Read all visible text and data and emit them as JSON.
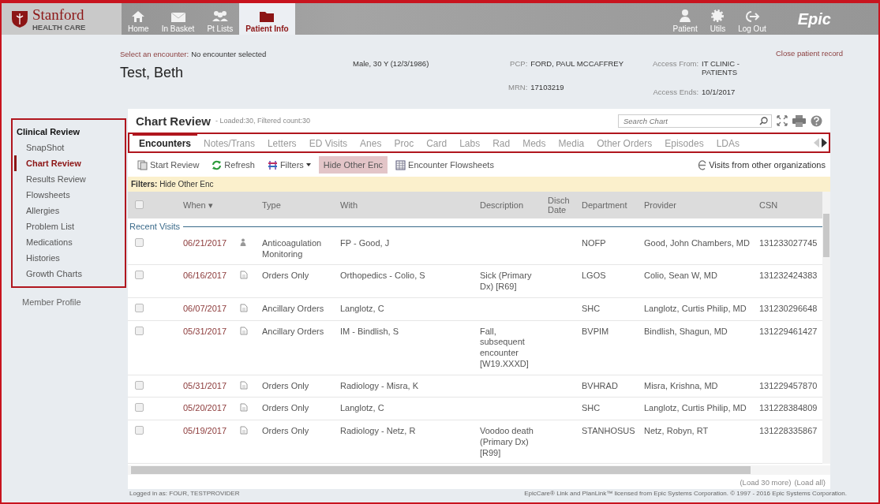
{
  "topbar": {
    "logo": {
      "name": "Stanford",
      "sub": "HEALTH CARE"
    },
    "nav_left": [
      {
        "label": "Home",
        "kind": "home",
        "selected": false
      },
      {
        "label": "In Basket",
        "kind": "mail",
        "selected": false
      },
      {
        "label": "Pt Lists",
        "kind": "people",
        "selected": false
      },
      {
        "label": "Patient Info",
        "kind": "folder",
        "selected": true
      }
    ],
    "nav_right": [
      {
        "label": "Patient",
        "kind": "person"
      },
      {
        "label": "Utils",
        "kind": "gear"
      },
      {
        "label": "Log Out",
        "kind": "logout"
      }
    ],
    "brand": "Epic"
  },
  "patient": {
    "encounter_label": "Select an encounter:",
    "encounter_value": "No encounter selected",
    "name": "Test, Beth",
    "demographics": "Male, 30 Y (12/3/1986)",
    "pcp_label": "PCP:",
    "pcp": "FORD, PAUL MCCAFFREY",
    "mrn_label": "MRN:",
    "mrn": "17103219",
    "access_from_label": "Access From:",
    "access_from": "IT CLINIC - PATIENTS",
    "access_ends_label": "Access Ends:",
    "access_ends": "10/1/2017",
    "close_link": "Close patient record"
  },
  "sidebar": {
    "heading": "Clinical Review",
    "items": [
      {
        "label": "SnapShot",
        "selected": false
      },
      {
        "label": "Chart Review",
        "selected": true
      },
      {
        "label": "Results Review",
        "selected": false
      },
      {
        "label": "Flowsheets",
        "selected": false
      },
      {
        "label": "Allergies",
        "selected": false
      },
      {
        "label": "Problem List",
        "selected": false
      },
      {
        "label": "Medications",
        "selected": false
      },
      {
        "label": "Histories",
        "selected": false
      },
      {
        "label": "Growth Charts",
        "selected": false
      }
    ],
    "other_items": [
      "Member Profile"
    ]
  },
  "chart_review": {
    "title": "Chart Review",
    "subtitle": "- Loaded:30, Filtered count:30",
    "search": {
      "placeholder": "Search Chart"
    },
    "tabs": [
      {
        "label": "Encounters",
        "selected": true
      },
      {
        "label": "Notes/Trans",
        "selected": false
      },
      {
        "label": "Letters",
        "selected": false
      },
      {
        "label": "ED Visits",
        "selected": false
      },
      {
        "label": "Anes",
        "selected": false
      },
      {
        "label": "Proc",
        "selected": false
      },
      {
        "label": "Card",
        "selected": false
      },
      {
        "label": "Labs",
        "selected": false
      },
      {
        "label": "Rad",
        "selected": false
      },
      {
        "label": "Meds",
        "selected": false
      },
      {
        "label": "Media",
        "selected": false
      },
      {
        "label": "Other Orders",
        "selected": false
      },
      {
        "label": "Episodes",
        "selected": false
      },
      {
        "label": "LDAs",
        "selected": false
      }
    ],
    "toolbar": [
      {
        "label": "Start Review",
        "kind": "review",
        "selected": false
      },
      {
        "label": "Refresh",
        "kind": "refresh",
        "selected": false
      },
      {
        "label": "Filters",
        "kind": "filters",
        "selected": false
      },
      {
        "label": "Hide Other Enc",
        "kind": "plain",
        "selected": true
      },
      {
        "label": "Encounter Flowsheets",
        "kind": "grid",
        "selected": false
      }
    ],
    "other_orgs": "Visits from other organizations",
    "filters_label": "Filters:",
    "filters_value": "Hide Other Enc",
    "table": {
      "select_all": {
        "checked": false
      },
      "columns": [
        "When ▾",
        "",
        "Type",
        "With",
        "Description",
        "Disch Date",
        "Department",
        "Provider",
        "CSN"
      ],
      "group": "Recent Visits",
      "rows": [
        {
          "checked": false,
          "when": "06/21/2017",
          "kind": "person",
          "type": "Anticoagulation Monitoring",
          "with": "FP - Good, J",
          "description": "",
          "department": "NOFP",
          "provider": "Good, John Chambers, MD",
          "csn": "131233027745"
        },
        {
          "checked": false,
          "when": "06/16/2017",
          "kind": "document",
          "type": "Orders Only",
          "with": "Orthopedics - Colio, S",
          "description": "Sick (Primary Dx) [R69]",
          "department": "LGOS",
          "provider": "Colio, Sean W, MD",
          "csn": "131232424383"
        },
        {
          "checked": false,
          "when": "06/07/2017",
          "kind": "document",
          "type": "Ancillary Orders",
          "with": "Langlotz, C",
          "description": "",
          "department": "SHC",
          "provider": "Langlotz, Curtis Philip, MD",
          "csn": "131230296648"
        },
        {
          "checked": false,
          "when": "05/31/2017",
          "kind": "document",
          "type": "Ancillary Orders",
          "with": "IM - Bindlish, S",
          "description": "Fall, subsequent encounter [W19.XXXD]",
          "department": "BVPIM",
          "provider": "Bindlish, Shagun, MD",
          "csn": "131229461427"
        },
        {
          "checked": false,
          "when": "05/31/2017",
          "kind": "document",
          "type": "Orders Only",
          "with": "Radiology - Misra, K",
          "description": "",
          "department": "BVHRAD",
          "provider": "Misra, Krishna, MD",
          "csn": "131229457870"
        },
        {
          "checked": false,
          "when": "05/20/2017",
          "kind": "document",
          "type": "Orders Only",
          "with": "Langlotz, C",
          "description": "",
          "department": "SHC",
          "provider": "Langlotz, Curtis Philip, MD",
          "csn": "131228384809"
        },
        {
          "checked": false,
          "when": "05/19/2017",
          "kind": "document",
          "type": "Orders Only",
          "with": "Radiology - Netz, R",
          "description": "Voodoo death (Primary Dx) [R99]",
          "department": "STANHOSUS",
          "provider": "Netz, Robyn, RT",
          "csn": "131228335867"
        }
      ]
    },
    "load_more": "(Load 30 more)",
    "load_all": "(Load all)"
  },
  "footer": {
    "left": "Logged in as: FOUR, TESTPROVIDER",
    "right": "EpicCare® Link and PlanLink™ licensed from Epic Systems Corporation. © 1997 - 2016 Epic Systems Corporation."
  }
}
